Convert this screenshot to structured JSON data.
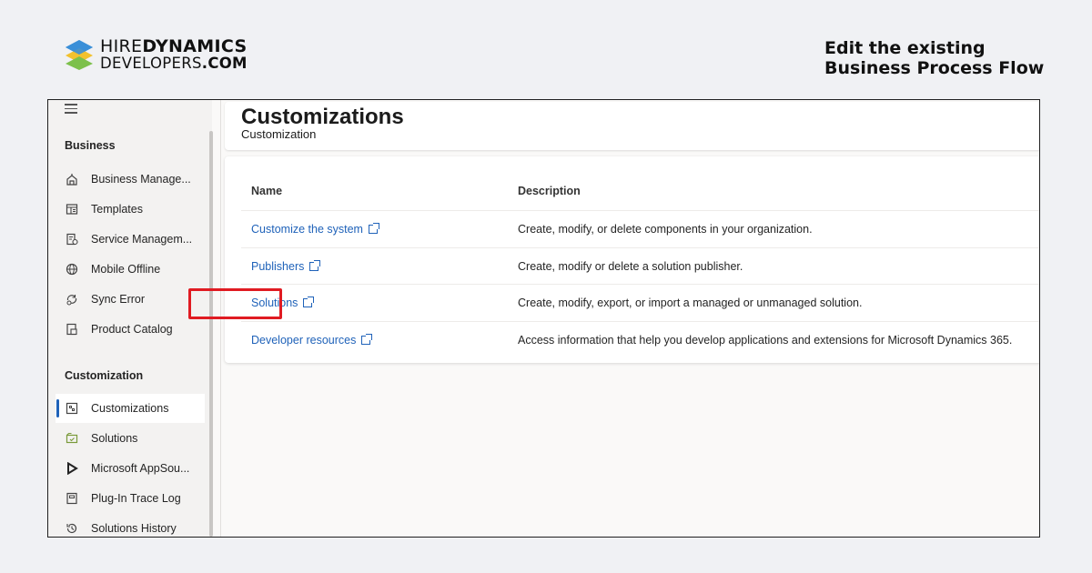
{
  "branding": {
    "line1_light": "HIRE",
    "line1_bold": "DYNAMICS",
    "line2_light": "DEVELOPERS",
    "line2_bold": ".COM",
    "colors": {
      "blue": "#3b8fd8",
      "yellow": "#f2c12e",
      "green": "#7cc04b"
    }
  },
  "heading": {
    "line1": "Edit the existing",
    "line2": "Business Process Flow"
  },
  "sidebar": {
    "business_title": "Business",
    "business_items": [
      {
        "label": "Business Manage...",
        "icon": "building-icon"
      },
      {
        "label": "Templates",
        "icon": "templates-icon"
      },
      {
        "label": "Service Managem...",
        "icon": "service-icon"
      },
      {
        "label": "Mobile Offline",
        "icon": "globe-icon"
      },
      {
        "label": "Sync Error",
        "icon": "sync-error-icon"
      },
      {
        "label": "Product Catalog",
        "icon": "product-catalog-icon"
      }
    ],
    "customization_title": "Customization",
    "customization_items": [
      {
        "label": "Customizations",
        "icon": "customizations-icon",
        "active": true
      },
      {
        "label": "Solutions",
        "icon": "solutions-icon"
      },
      {
        "label": "Microsoft AppSou...",
        "icon": "appsource-icon"
      },
      {
        "label": "Plug-In Trace Log",
        "icon": "trace-log-icon"
      },
      {
        "label": "Solutions History",
        "icon": "history-icon"
      }
    ]
  },
  "main": {
    "title": "Customizations",
    "subtitle": "Customization",
    "columns": {
      "name": "Name",
      "description": "Description"
    },
    "rows": [
      {
        "name": "Customize the system",
        "description": "Create, modify, or delete components in your organization."
      },
      {
        "name": "Publishers",
        "description": "Create, modify or delete a solution publisher."
      },
      {
        "name": "Solutions",
        "description": "Create, modify, export, or import a managed or unmanaged solution.",
        "highlighted": true
      },
      {
        "name": "Developer resources",
        "description": "Access information that help you develop applications and extensions for Microsoft Dynamics 365."
      }
    ],
    "link_color": "#1f62b9",
    "highlight_color": "#e01b22"
  }
}
